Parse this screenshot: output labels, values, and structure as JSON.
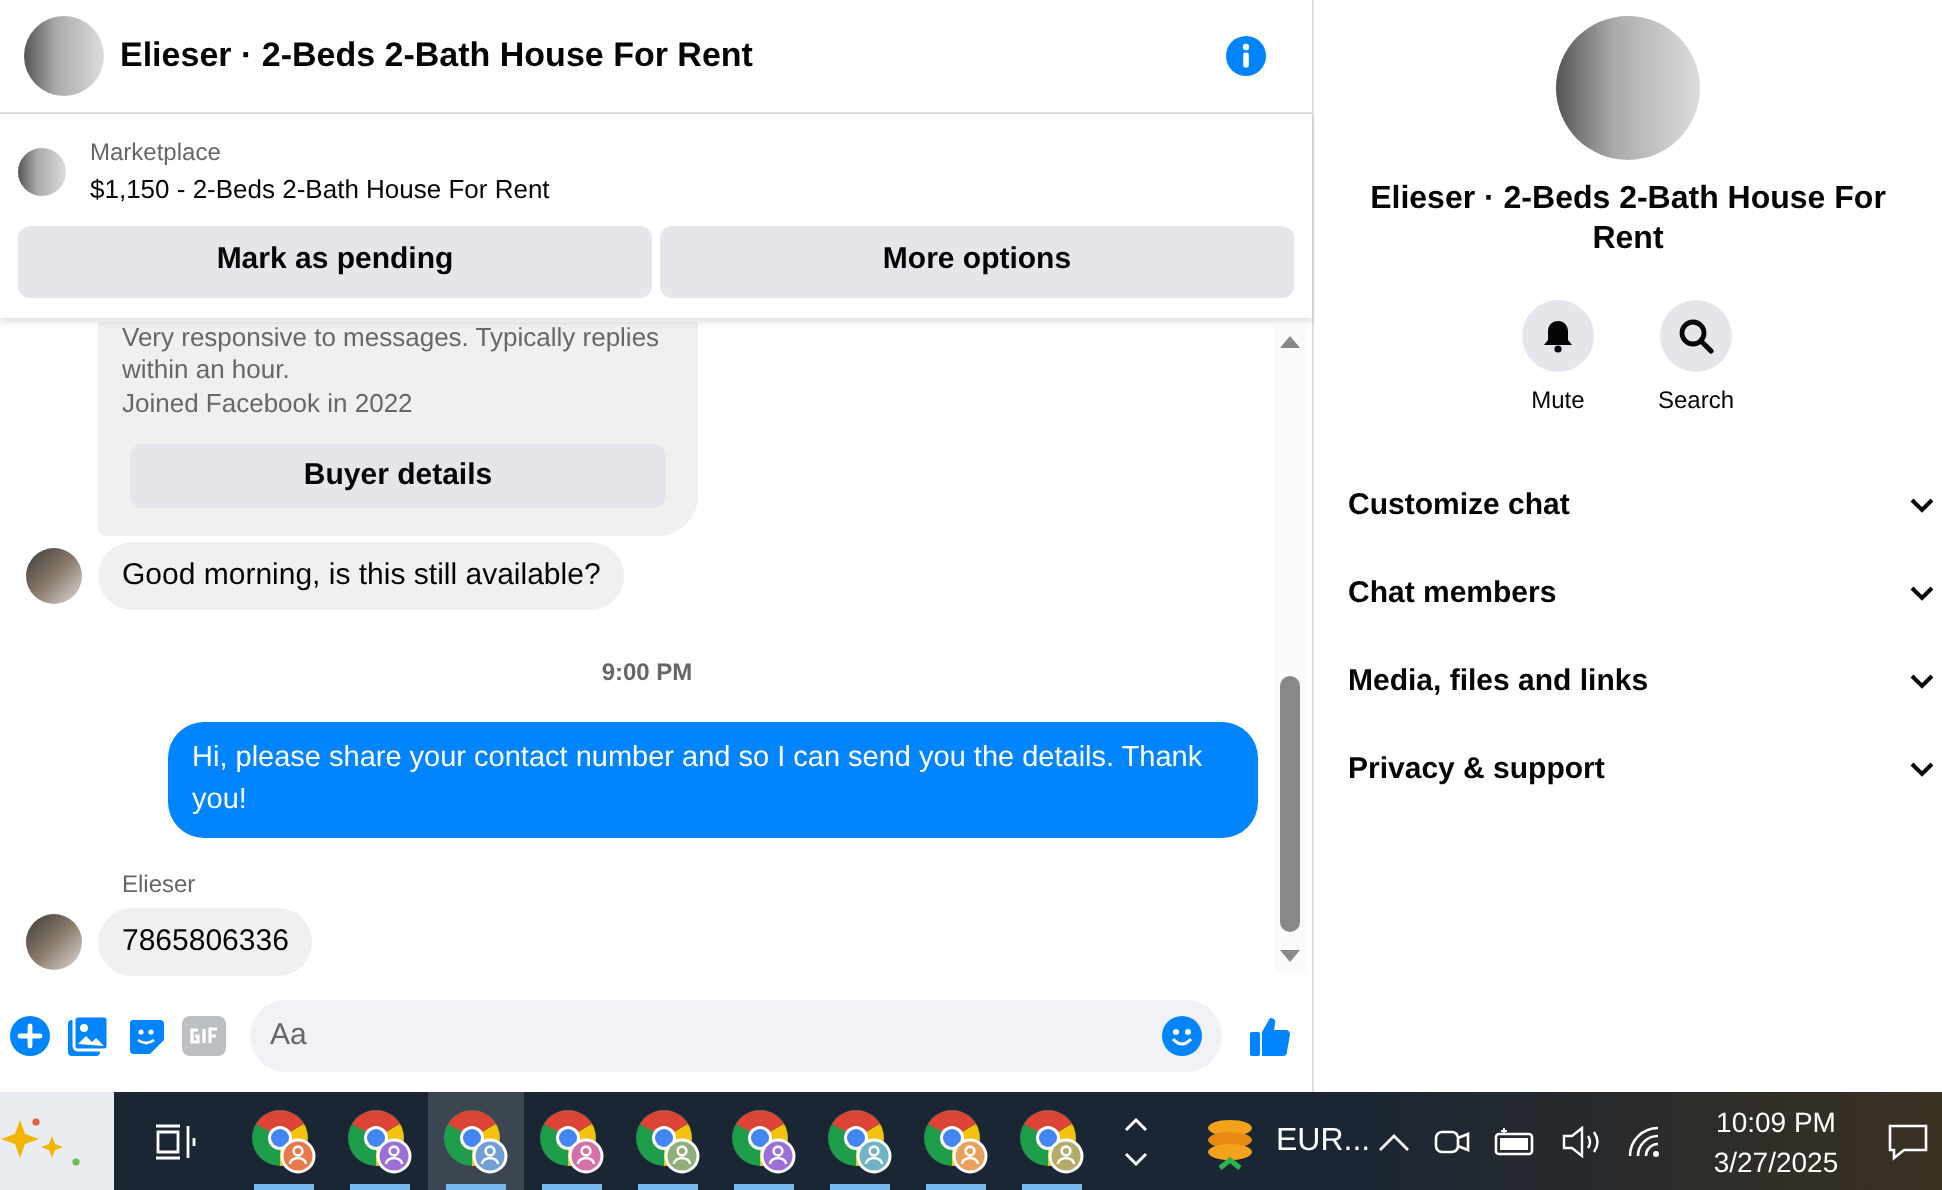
{
  "header": {
    "title": "Elieser · 2-Beds 2-Bath House For Rent"
  },
  "listing": {
    "source": "Marketplace",
    "title": "$1,150 - 2-Beds 2-Bath House For Rent"
  },
  "actions": [
    "Mark as pending",
    "More options"
  ],
  "messages": [
    {
      "kind": "card",
      "lines": [
        "Very responsive to messages. Typically replies",
        "within an hour.",
        "Joined Facebook in 2022"
      ],
      "button": "Buyer details"
    },
    {
      "kind": "incoming",
      "text": "Good morning, is this still available?"
    },
    {
      "kind": "timestamp",
      "text": "9:00 PM"
    },
    {
      "kind": "outgoing",
      "text": "Hi, please share your contact number and so I can send you the details. Thank you!"
    },
    {
      "kind": "sender",
      "text": "Elieser"
    },
    {
      "kind": "incoming",
      "text": "7865806336"
    }
  ],
  "composer": {
    "placeholder": "Aa"
  },
  "details": {
    "title": "Elieser · 2-Beds 2-Bath House For Rent",
    "buttons": [
      {
        "kind": "bell",
        "label": "Mute"
      },
      {
        "kind": "search",
        "label": "Search"
      }
    ],
    "sections": [
      {
        "label": "Customize chat",
        "expanded": false
      },
      {
        "label": "Chat members",
        "expanded": false
      },
      {
        "label": "Media, files and links",
        "expanded": false
      },
      {
        "label": "Privacy & support",
        "expanded": false
      }
    ]
  },
  "taskbar": {
    "apps": [
      {
        "color": "#e8784a",
        "selected": false
      },
      {
        "color": "#9b6fd6",
        "selected": false
      },
      {
        "color": "#6f9fd6",
        "selected": true
      },
      {
        "color": "#d66fa8",
        "selected": false
      },
      {
        "color": "#8fae7a",
        "selected": false
      },
      {
        "color": "#9b6fd6",
        "selected": false
      },
      {
        "color": "#6fb4c4",
        "selected": false
      },
      {
        "color": "#e8a05a",
        "selected": false
      },
      {
        "color": "#b4aa6a",
        "selected": false
      }
    ],
    "widget": "EUR...",
    "time": "10:09 PM",
    "date": "3/27/2025"
  }
}
